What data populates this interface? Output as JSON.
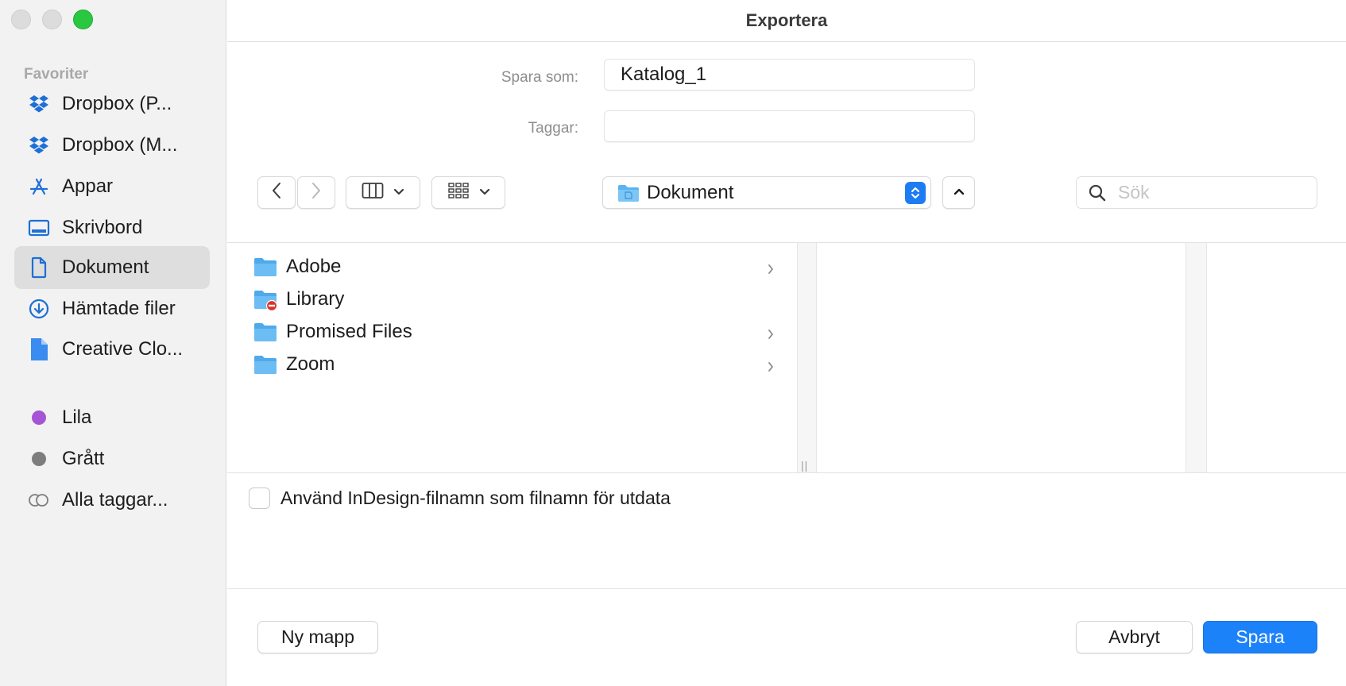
{
  "window": {
    "title": "Exportera"
  },
  "sidebar": {
    "section_title": "Favoriter",
    "items": [
      {
        "label": "Dropbox (P...",
        "icon": "dropbox-icon"
      },
      {
        "label": "Dropbox (M...",
        "icon": "dropbox-icon"
      },
      {
        "label": "Appar",
        "icon": "apps-icon"
      },
      {
        "label": "Skrivbord",
        "icon": "desktop-icon"
      },
      {
        "label": "Dokument",
        "icon": "document-icon",
        "selected": true
      },
      {
        "label": "Hämtade filer",
        "icon": "download-icon"
      },
      {
        "label": "Creative Clo...",
        "icon": "file-icon"
      }
    ],
    "tags": [
      {
        "label": "Lila",
        "color": "#a654d6"
      },
      {
        "label": "Grått",
        "color": "#7d7d7d"
      },
      {
        "label": "Alla taggar...",
        "icon": "all-tags-icon"
      }
    ]
  },
  "form": {
    "save_as_label": "Spara som:",
    "save_as_value": "Katalog_1",
    "tags_label": "Taggar:",
    "tags_value": ""
  },
  "toolbar": {
    "location": "Dokument",
    "search_placeholder": "Sök"
  },
  "browser": {
    "items": [
      {
        "name": "Adobe",
        "has_children": true,
        "restricted": false
      },
      {
        "name": "Library",
        "has_children": false,
        "restricted": true
      },
      {
        "name": "Promised Files",
        "has_children": true,
        "restricted": false
      },
      {
        "name": "Zoom",
        "has_children": true,
        "restricted": false
      }
    ]
  },
  "options": {
    "use_filename_label": "Använd InDesign-filnamn som filnamn för utdata",
    "use_filename_checked": false
  },
  "buttons": {
    "new_folder": "Ny mapp",
    "cancel": "Avbryt",
    "save": "Spara"
  },
  "colors": {
    "accent": "#1c82fa",
    "folder": "#5ab4f0",
    "sidebar_icon": "#1d6fd6"
  }
}
